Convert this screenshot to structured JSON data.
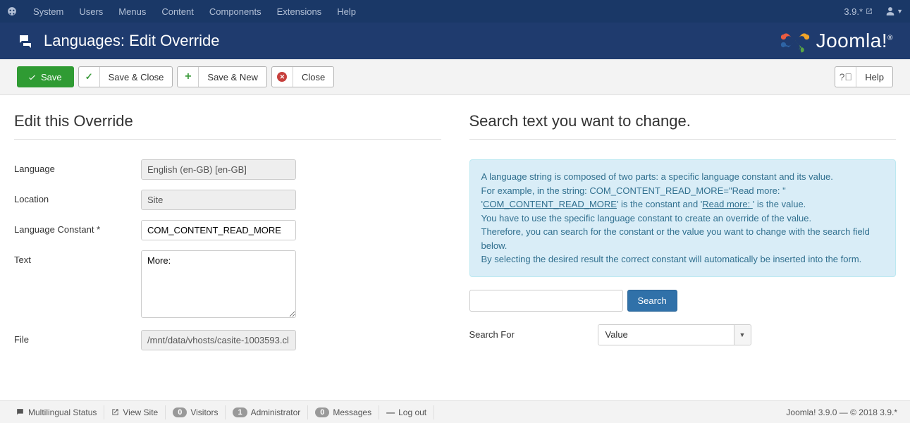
{
  "topnav": {
    "menu": [
      "System",
      "Users",
      "Menus",
      "Content",
      "Components",
      "Extensions",
      "Help"
    ],
    "version": "3.9.*"
  },
  "header": {
    "title": "Languages: Edit Override",
    "logo_text": "Joomla!"
  },
  "toolbar": {
    "save": "Save",
    "save_close": "Save & Close",
    "save_new": "Save & New",
    "close": "Close",
    "help": "Help"
  },
  "left": {
    "heading": "Edit this Override",
    "language_label": "Language",
    "language_value": "English (en-GB) [en-GB]",
    "location_label": "Location",
    "location_value": "Site",
    "constant_label": "Language Constant *",
    "constant_value": "COM_CONTENT_READ_MORE",
    "text_label": "Text",
    "text_value": "More:",
    "file_label": "File",
    "file_value": "/mnt/data/vhosts/casite-1003593.cl"
  },
  "right": {
    "heading": "Search text you want to change.",
    "alert": {
      "l1": "A language string is composed of two parts: a specific language constant and its value.",
      "l2": "For example, in the string: COM_CONTENT_READ_MORE=\"Read more: \"",
      "l3a": "'",
      "l3b": "COM_CONTENT_READ_MORE",
      "l3c": "' is the constant and '",
      "l3d": "Read more: ",
      "l3e": "' is the value.",
      "l4": "You have to use the specific language constant to create an override of the value.",
      "l5": "Therefore, you can search for the constant or the value you want to change with the search field below.",
      "l6": "By selecting the desired result the correct constant will automatically be inserted into the form."
    },
    "search_btn": "Search",
    "search_for_label": "Search For",
    "search_for_value": "Value"
  },
  "status": {
    "multilingual": "Multilingual Status",
    "view_site": "View Site",
    "visitors_badge": "0",
    "visitors": "Visitors",
    "admin_badge": "1",
    "admin": "Administrator",
    "messages_badge": "0",
    "messages": "Messages",
    "logout": "Log out",
    "right": "Joomla! 3.9.0  —  © 2018 3.9.*"
  }
}
